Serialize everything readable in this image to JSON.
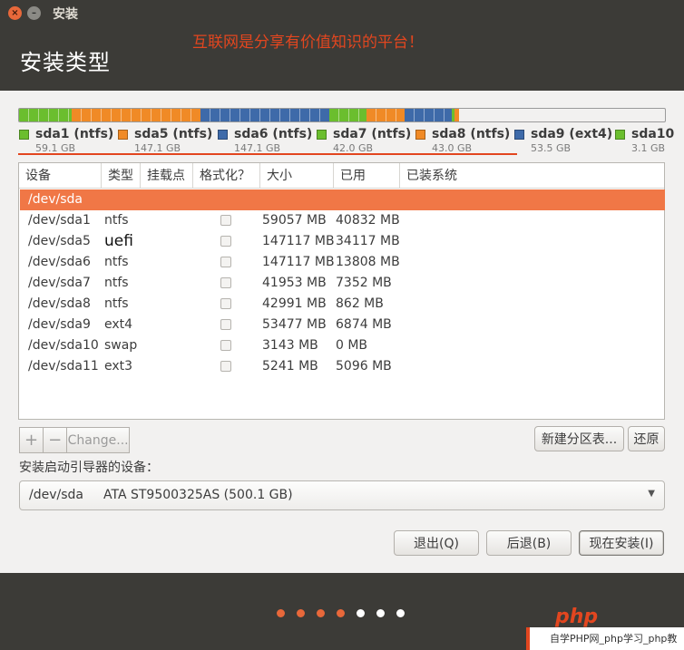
{
  "window": {
    "title": "安装"
  },
  "header": {
    "page_title": "安装类型",
    "overlay_note": "互联网是分享有价值知识的平台！"
  },
  "partition_bar": {
    "segments": [
      {
        "name": "sda1",
        "fs": "ntfs",
        "color": "#6bbe2e",
        "share": 0.081
      },
      {
        "name": "sda5",
        "fs": "ntfs",
        "color": "#f08a26",
        "share": 0.2
      },
      {
        "name": "sda6",
        "fs": "ntfs",
        "color": "#3e6aa9",
        "share": 0.2
      },
      {
        "name": "sda7",
        "fs": "ntfs",
        "color": "#6bbe2e",
        "share": 0.057
      },
      {
        "name": "sda8",
        "fs": "ntfs",
        "color": "#f08a26",
        "share": 0.059
      },
      {
        "name": "sda9",
        "fs": "ext4",
        "color": "#3e6aa9",
        "share": 0.073
      },
      {
        "name": "sda10",
        "fs": "swap",
        "color": "#6bbe2e",
        "share": 0.004
      },
      {
        "name": "sda11",
        "fs": "ext3",
        "color": "#f08a26",
        "share": 0.007
      }
    ]
  },
  "legend": [
    {
      "label": "sda1 (ntfs)",
      "size": "59.1 GB",
      "color": "#6bbe2e"
    },
    {
      "label": "sda5 (ntfs)",
      "size": "147.1 GB",
      "color": "#f08a26"
    },
    {
      "label": "sda6 (ntfs)",
      "size": "147.1 GB",
      "color": "#3e6aa9"
    },
    {
      "label": "sda7 (ntfs)",
      "size": "42.0 GB",
      "color": "#6bbe2e"
    },
    {
      "label": "sda8 (ntfs)",
      "size": "43.0 GB",
      "color": "#f08a26"
    },
    {
      "label": "sda9 (ext4)",
      "size": "53.5 GB",
      "color": "#3e6aa9"
    },
    {
      "label": "sda10",
      "size": "3.1 GB",
      "color": "#6bbe2e"
    }
  ],
  "table": {
    "columns": [
      "设备",
      "类型",
      "挂载点",
      "格式化？",
      "大小",
      "已用",
      "已装系统"
    ],
    "disk_row": "/dev/sda",
    "rows": [
      {
        "device": "/dev/sda1",
        "type": "ntfs",
        "mount": "",
        "format": false,
        "size": "59057 MB",
        "used": "40832 MB",
        "system": ""
      },
      {
        "device": "/dev/sda5",
        "type": "uefi",
        "mount": "",
        "format": false,
        "size": "147117 MB",
        "used": "34117 MB",
        "system": ""
      },
      {
        "device": "/dev/sda6",
        "type": "ntfs",
        "mount": "",
        "format": false,
        "size": "147117 MB",
        "used": "13808 MB",
        "system": ""
      },
      {
        "device": "/dev/sda7",
        "type": "ntfs",
        "mount": "",
        "format": false,
        "size": "41953 MB",
        "used": "7352 MB",
        "system": ""
      },
      {
        "device": "/dev/sda8",
        "type": "ntfs",
        "mount": "",
        "format": false,
        "size": "42991 MB",
        "used": "862 MB",
        "system": ""
      },
      {
        "device": "/dev/sda9",
        "type": "ext4",
        "mount": "",
        "format": false,
        "size": "53477 MB",
        "used": "6874 MB",
        "system": ""
      },
      {
        "device": "/dev/sda10",
        "type": "swap",
        "mount": "",
        "format": false,
        "size": "3143 MB",
        "used": "0 MB",
        "system": ""
      },
      {
        "device": "/dev/sda11",
        "type": "ext3",
        "mount": "",
        "format": false,
        "size": "5241 MB",
        "used": "5096 MB",
        "system": ""
      }
    ]
  },
  "toolbar": {
    "add": "+",
    "remove": "−",
    "change": "Change...",
    "new_table": "新建分区表...",
    "revert": "还原"
  },
  "bootloader": {
    "label": "安装启动引导器的设备：",
    "device": "/dev/sda",
    "model": "ATA ST9500325AS (500.1 GB)"
  },
  "actions": {
    "quit": "退出(Q)",
    "back": "后退(B)",
    "install": "现在安装(I)"
  },
  "progress": {
    "total_steps": 7,
    "completed_steps": 4,
    "active_color": "#e8683a",
    "inactive_color": "#ffffff"
  },
  "watermark": {
    "logo": "php",
    "bottom_text": "自学PHP网_php学习_php教"
  }
}
